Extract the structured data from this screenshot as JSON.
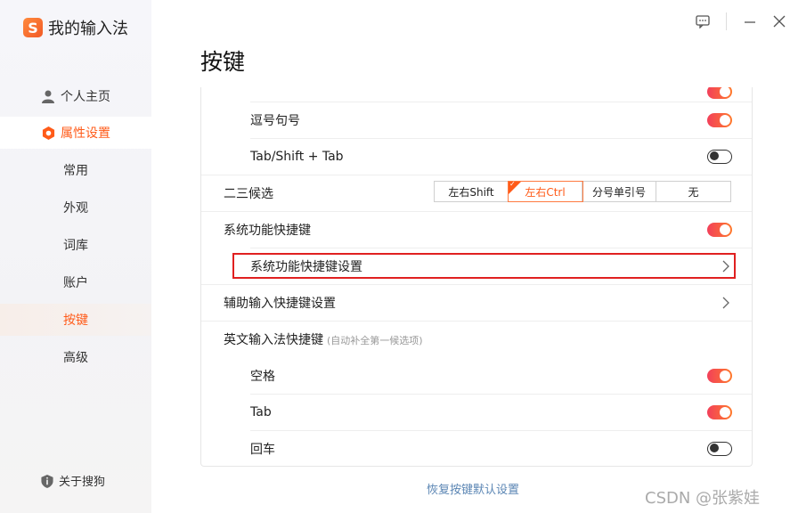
{
  "app": {
    "title": "我的输入法",
    "logo_letter": "S",
    "brand_color": "#ff5b19"
  },
  "sidebar": {
    "items": [
      {
        "label": "个人主页",
        "icon": "person-icon"
      },
      {
        "label": "属性设置",
        "icon": "hexagon-settings-icon"
      },
      {
        "label": "常用"
      },
      {
        "label": "外观"
      },
      {
        "label": "词库"
      },
      {
        "label": "账户"
      },
      {
        "label": "按键"
      },
      {
        "label": "高级"
      }
    ],
    "about": {
      "label": "关于搜狗",
      "icon": "shield-info-icon"
    }
  },
  "window_controls": [
    "feedback-icon",
    "minimize-icon",
    "close-icon"
  ],
  "page": {
    "title": "按键"
  },
  "settings": {
    "partial_row": {
      "label": "",
      "state": "on"
    },
    "comma_period": {
      "label": "逗号句号",
      "state": "on"
    },
    "tab_shift_tab": {
      "label": "Tab/Shift + Tab",
      "state": "off"
    },
    "second_third": {
      "label": "二三候选",
      "options": [
        "左右Shift",
        "左右Ctrl",
        "分号单引号",
        "无"
      ],
      "selected": "左右Ctrl"
    },
    "system_hotkeys": {
      "label": "系统功能快捷键",
      "state": "on"
    },
    "system_hotkeys_settings": {
      "label": "系统功能快捷键设置"
    },
    "aux_input_settings": {
      "label": "辅助输入快捷键设置"
    },
    "english_hotkey": {
      "label": "英文输入法快捷键",
      "hint": "(自动补全第一候选项)"
    },
    "space": {
      "label": "空格",
      "state": "on"
    },
    "tab": {
      "label": "Tab",
      "state": "on"
    },
    "enter": {
      "label": "回车",
      "state": "off"
    }
  },
  "footer": {
    "restore_label": "恢复按键默认设置"
  },
  "watermark": "CSDN @张紫娃"
}
